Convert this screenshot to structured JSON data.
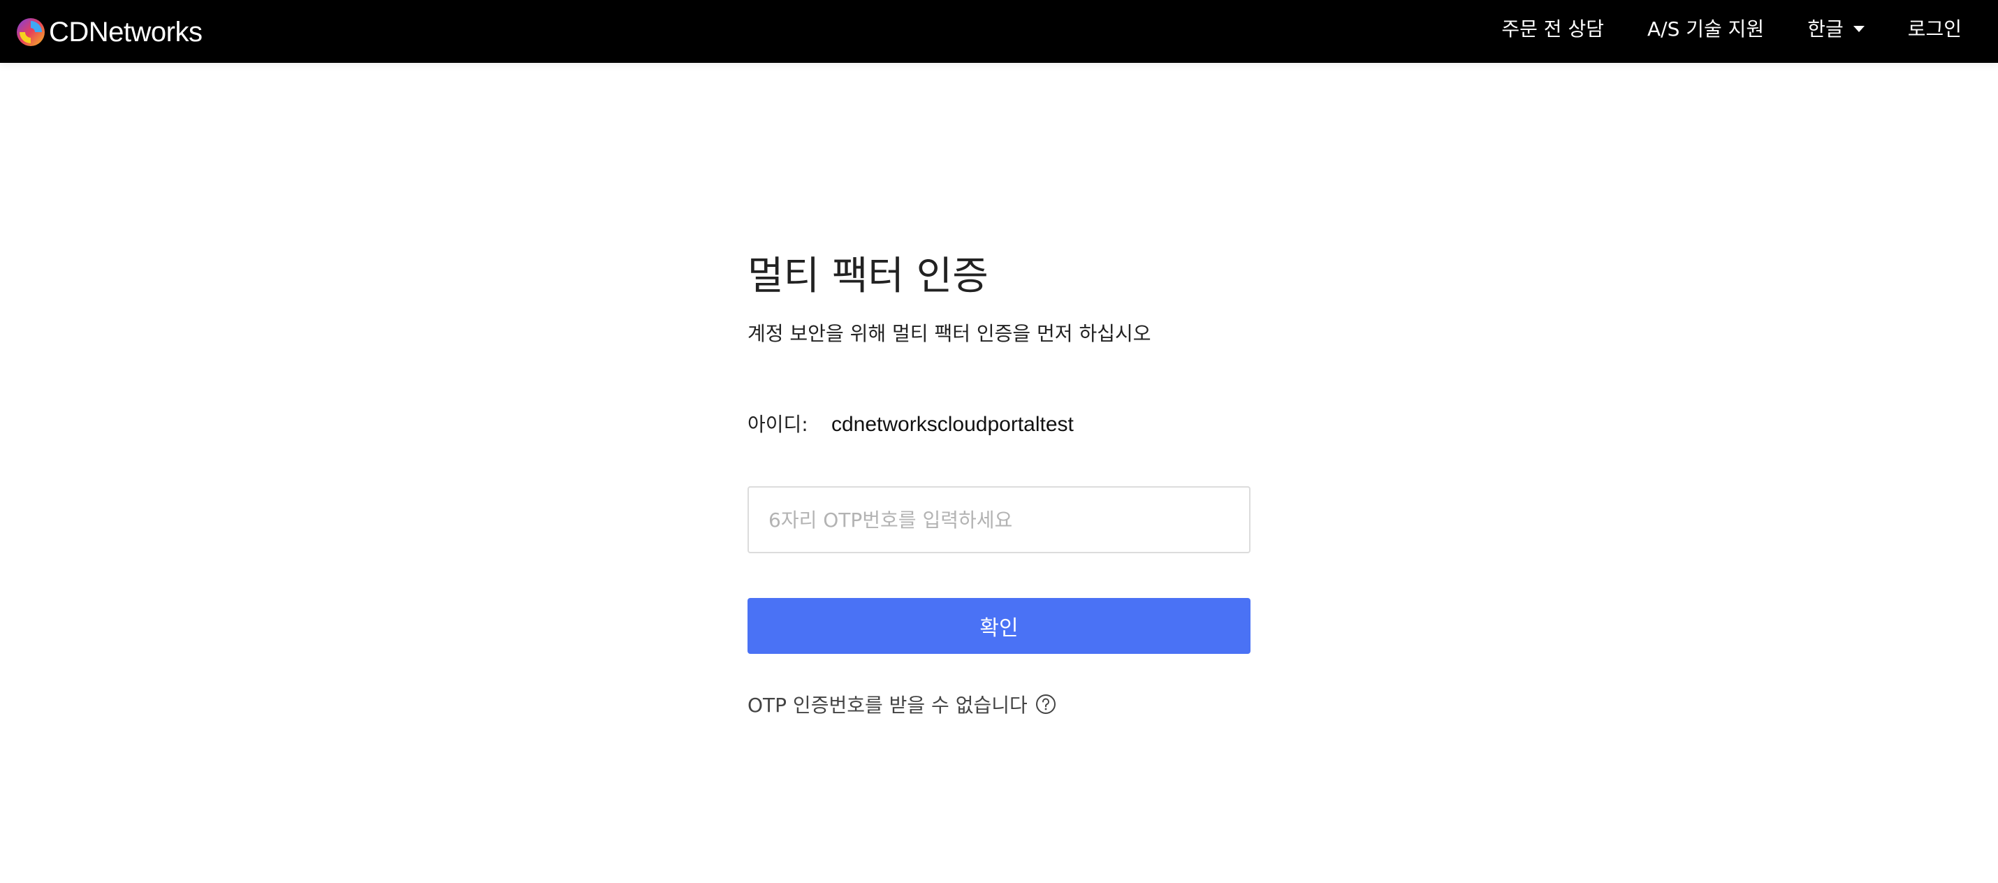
{
  "header": {
    "brand": "CDNetworks",
    "nav": {
      "presales": "주문 전 상담",
      "support": "A/S 기술 지원",
      "language": "한글",
      "login": "로그인"
    }
  },
  "mfa": {
    "title": "멀티 팩터 인증",
    "subtitle": "계정 보안을 위해 멀티 팩터 인증을 먼저 하십시오",
    "id_label": "아이디:",
    "id_value": "cdnetworkscloudportaltest",
    "otp_placeholder": "6자리 OTP번호를 입력하세요",
    "otp_value": "",
    "confirm_label": "확인",
    "help_text": "OTP 인증번호를 받을 수 없습니다"
  },
  "icons": {
    "logo": "cdnetworks-logo-icon",
    "language_dropdown": "caret-down-icon",
    "help": "question-circle-icon"
  },
  "colors": {
    "header_bg": "#000000",
    "primary": "#4a72f5",
    "text": "#222222",
    "placeholder": "#b3b3b3"
  }
}
